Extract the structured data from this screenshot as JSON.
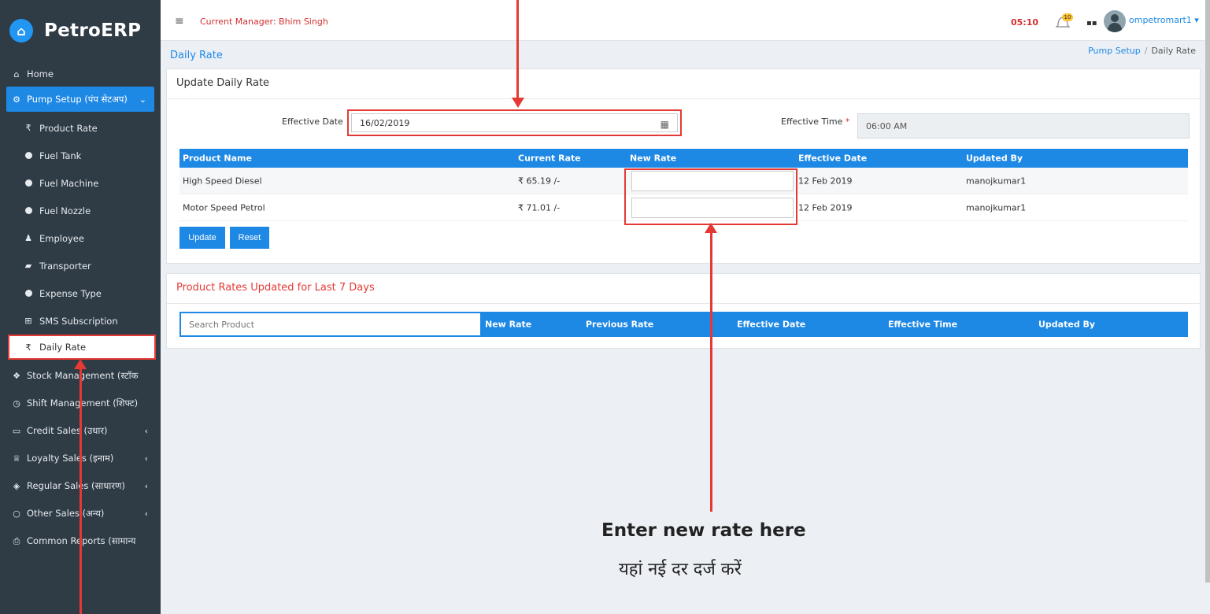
{
  "brand": {
    "name": "PetroERP",
    "icon": "logo-icon"
  },
  "topbar": {
    "menu_icon": "≡",
    "manager": "Current Manager: Bhim Singh",
    "timer": "05:10",
    "notification_count": "10",
    "username": "ompetromart1"
  },
  "page": {
    "title": "Daily Rate"
  },
  "breadcrumb": {
    "parent": "Pump Setup",
    "separator": "/",
    "current": "Daily Rate"
  },
  "sidebar": {
    "items": [
      {
        "label": "Home",
        "icon": "home-icon"
      },
      {
        "label": "Pump Setup (पंप सेटअप)",
        "icon": "cogs-icon"
      },
      {
        "label": "Product Rate",
        "icon": "rupee-icon"
      },
      {
        "label": "Fuel Tank",
        "icon": "dot-icon"
      },
      {
        "label": "Fuel Machine",
        "icon": "dot-icon"
      },
      {
        "label": "Fuel Nozzle",
        "icon": "dot-icon"
      },
      {
        "label": "Employee",
        "icon": "user-icon"
      },
      {
        "label": "Transporter",
        "icon": "truck-icon"
      },
      {
        "label": "Expense Type",
        "icon": "dot-icon"
      },
      {
        "label": "SMS Subscription",
        "icon": "plus-square-icon"
      },
      {
        "label": "Daily Rate",
        "icon": "rupee-icon"
      },
      {
        "label": "Stock Management (स्टॉक",
        "icon": "cubes-icon"
      },
      {
        "label": "Shift Management (शिफ्ट)",
        "icon": "clock-icon"
      },
      {
        "label": "Credit Sales (उधार)",
        "icon": "card-icon"
      },
      {
        "label": "Loyalty Sales (इनाम)",
        "icon": "trophy-icon"
      },
      {
        "label": "Regular Sales (साधारण)",
        "icon": "cube-icon"
      },
      {
        "label": "Other Sales (अन्य)",
        "icon": "circle-icon"
      },
      {
        "label": "Common Reports (सामान्य",
        "icon": "print-icon"
      }
    ]
  },
  "update_panel": {
    "title": "Update Daily Rate",
    "effective_date_label": "Effective Date",
    "effective_date_value": "16/02/2019",
    "effective_time_label": "Effective Time",
    "required_mark": "*",
    "effective_time_value": "06:00 AM",
    "columns": [
      "Product Name",
      "Current Rate",
      "New Rate",
      "Effective Date",
      "Updated By"
    ],
    "rows": [
      {
        "product": "High Speed Diesel",
        "current_rate": "₹ 65.19 /-",
        "new_rate": "",
        "effective_date": "12 Feb 2019",
        "updated_by": "manojkumar1"
      },
      {
        "product": "Motor Speed Petrol",
        "current_rate": "₹ 71.01 /-",
        "new_rate": "",
        "effective_date": "12 Feb 2019",
        "updated_by": "manojkumar1"
      }
    ],
    "update_button": "Update",
    "reset_button": "Reset"
  },
  "history_panel": {
    "title": "Product Rates Updated for Last 7 Days",
    "search_placeholder": "Search Product",
    "columns": [
      "New Rate",
      "Previous Rate",
      "Effective Date",
      "Effective Time",
      "Updated By"
    ]
  },
  "annotation": {
    "english": "Enter new rate here",
    "hindi": "यहां नई दर दर्ज करें",
    "color": "#e53935"
  },
  "colors": {
    "primary": "#1e88e5",
    "sidebar": "#2f3b45",
    "alert": "#e53935"
  }
}
